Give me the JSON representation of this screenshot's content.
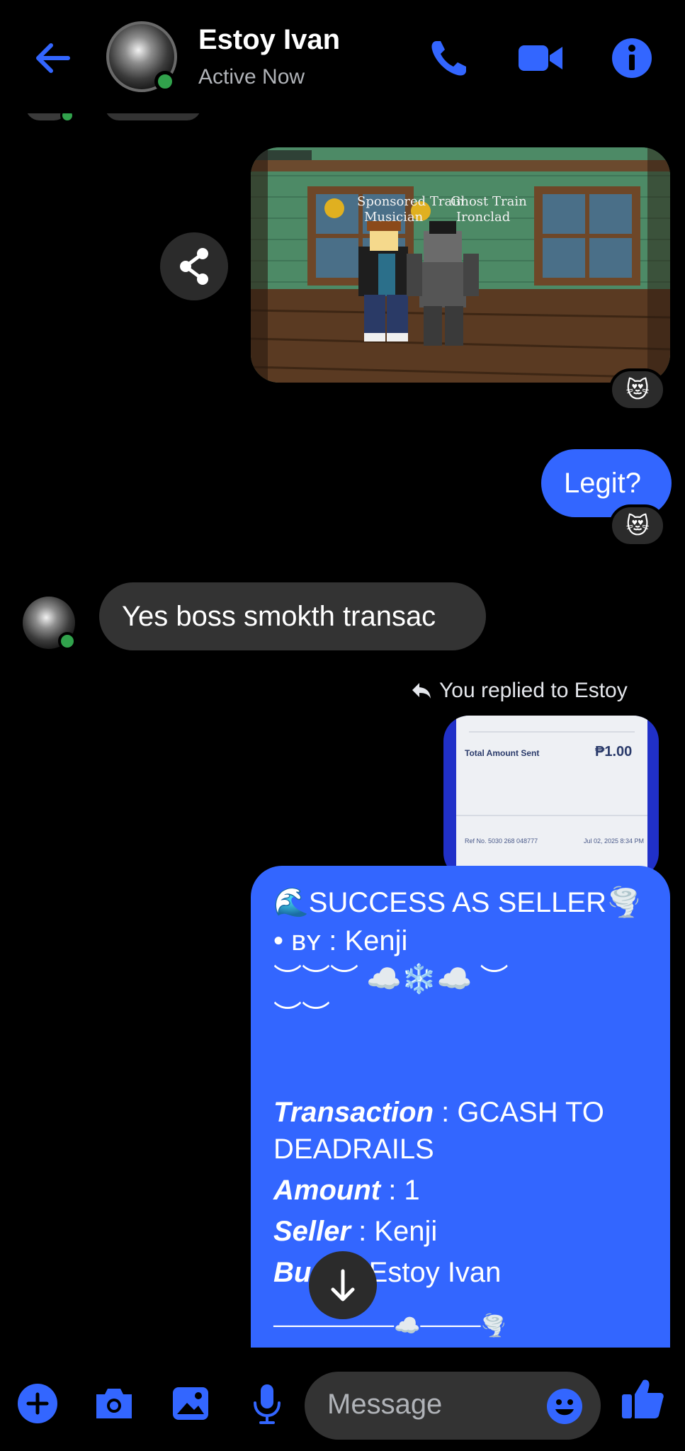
{
  "header": {
    "contact_name": "Estoy Ivan",
    "status": "Active Now"
  },
  "image_message": {
    "overlay_tags": [
      "Sponsored Train Musician",
      "Ghost Train Ironclad"
    ],
    "reaction": "😻"
  },
  "messages": {
    "outgoing_1": "Legit?",
    "outgoing_1_reaction": "😻",
    "incoming_1": "Yes boss smokth transac"
  },
  "reply_context": {
    "label": "You replied to Estoy",
    "receipt_total_label": "Total Amount Sent",
    "receipt_total_value": "₱1.00",
    "receipt_ref": "Ref No. 5030 268 048777",
    "receipt_date": "Jul 02, 2025 8:34 PM"
  },
  "seller_message": {
    "line_title": "🌊SUCCESS AS SELLER🌪️",
    "line_by": "• ʙʏ : Kenji",
    "line_deco1": "︶︶︶ ☁️❄️☁️ ︶",
    "line_deco2": "︶︶",
    "transaction_key": "Transaction",
    "transaction_value": " : GCASH TO",
    "transaction_value2": "DEADRAILS",
    "amount_key": "Amount",
    "amount_value": " : 1",
    "seller_key": "Seller",
    "seller_value": " : Kenji",
    "buyer_key": "Bu",
    "buyer_value": " : Estoy Ivan",
    "footer_line": "────────☁️────🌪️"
  },
  "composer": {
    "placeholder": "Message"
  },
  "colors": {
    "accent": "#3366ff",
    "online": "#31a24c",
    "bubble_in": "#333333"
  },
  "icons": [
    "back-arrow-icon",
    "phone-icon",
    "video-camera-icon",
    "info-icon",
    "share-icon",
    "reply-arrow-icon",
    "arrow-down-icon",
    "plus-icon",
    "camera-icon",
    "gallery-icon",
    "microphone-icon",
    "emoji-icon",
    "thumbs-up-icon"
  ]
}
